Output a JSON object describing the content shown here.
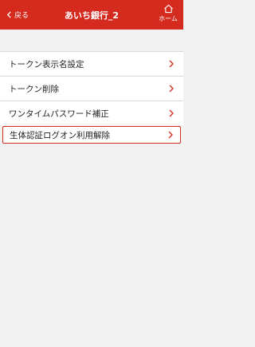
{
  "colors": {
    "header_bg": "#d52b1e",
    "chevron": "#d52b1e",
    "background": "#f2f2f2"
  },
  "header": {
    "back_label": "戻る",
    "title": "あいち銀行_2",
    "home_label": "ホーム",
    "back_icon": "chevron-left-icon",
    "home_icon": "home-icon"
  },
  "menu": {
    "items": [
      {
        "label": "トークン表示名設定",
        "selected": false
      },
      {
        "label": "トークン削除",
        "selected": false
      },
      {
        "label": "ワンタイムパスワード補正",
        "selected": false
      },
      {
        "label": "生体認証ログオン利用解除",
        "selected": true
      }
    ]
  }
}
